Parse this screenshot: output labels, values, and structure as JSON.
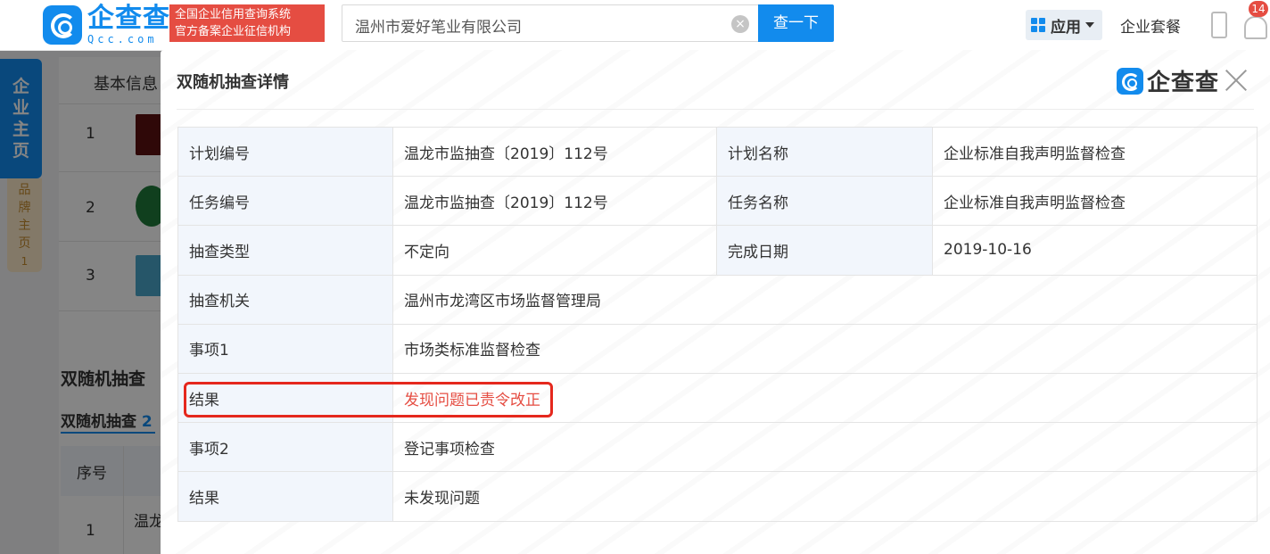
{
  "header": {
    "logo_cn": "企查查",
    "logo_en": "Qcc.com",
    "slogan_line1": "全国企业信用查询系统",
    "slogan_line2": "官方备案企业征信机构",
    "search_value": "温州市爱好笔业有限公司",
    "search_button": "查一下",
    "apps_label": "应用",
    "packages_label": "企业套餐",
    "notification_count": "14"
  },
  "sidebar": {
    "main_label": [
      "企",
      "业",
      "主",
      "页"
    ],
    "brand_label": [
      "品",
      "牌",
      "主",
      "页"
    ],
    "brand_count": "1"
  },
  "background": {
    "tab_label": "基本信息",
    "rows": [
      "1",
      "2",
      "3"
    ],
    "section_title": "双随机抽查",
    "subtab_label": "双随机抽查",
    "subtab_count": "2",
    "thead_label": "序号",
    "first_row_no": "1",
    "first_row_text": "温龙"
  },
  "modal": {
    "title": "双随机抽查详情",
    "logo_text": "企查查",
    "rows": [
      {
        "k1": "计划编号",
        "v1": "温龙市监抽查〔2019〕112号",
        "k2": "计划名称",
        "v2": "企业标准自我声明监督检查"
      },
      {
        "k1": "任务编号",
        "v1": "温龙市监抽查〔2019〕112号",
        "k2": "任务名称",
        "v2": "企业标准自我声明监督检查"
      },
      {
        "k1": "抽查类型",
        "v1": "不定向",
        "k2": "完成日期",
        "v2": "2019-10-16"
      },
      {
        "k1": "抽查机关",
        "v1": "温州市龙湾区市场监督管理局"
      },
      {
        "k1": "事项1",
        "v1": "市场类标准监督检查"
      },
      {
        "k1": "结果",
        "v1": "发现问题已责令改正"
      },
      {
        "k1": "事项2",
        "v1": "登记事项检查"
      },
      {
        "k1": "结果",
        "v1": "未发现问题"
      }
    ]
  },
  "colors": {
    "brand_blue": "#128bed",
    "alert_red": "#e54d42",
    "key_cell_bg": "#f2f6fc"
  }
}
